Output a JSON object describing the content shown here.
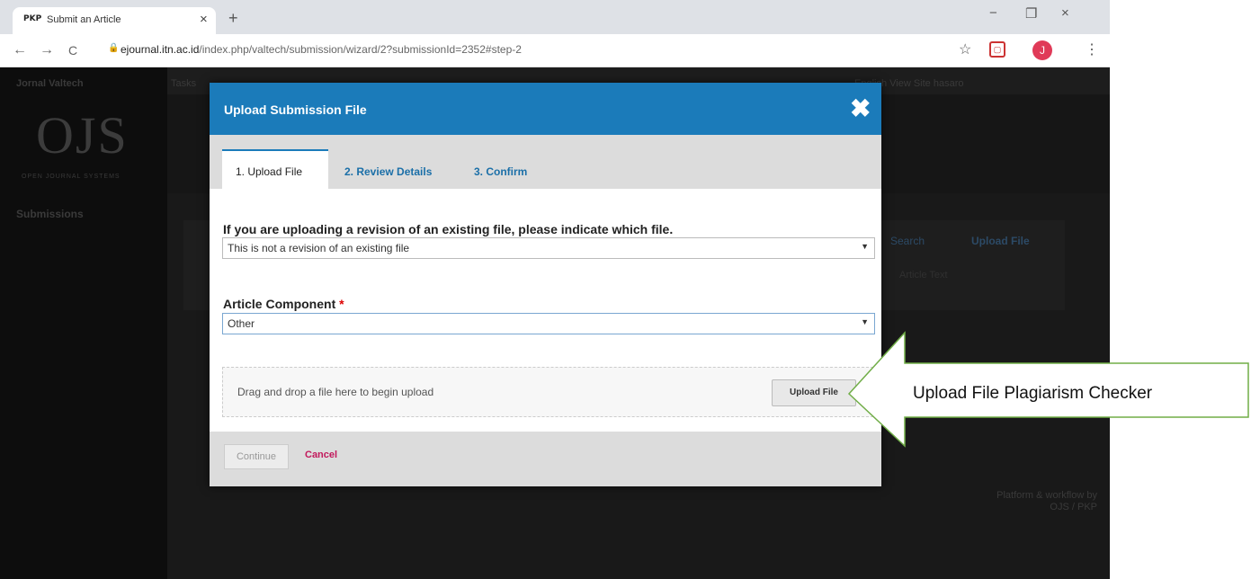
{
  "browser": {
    "tab_favicon": "PKP",
    "tab_title": "Submit an Article",
    "tab_close": "×",
    "new_tab": "+",
    "url_host": "ejournal.itn.ac.id",
    "url_path": "/index.php/valtech/submission/wizard/2?submissionId=2352#step-2",
    "profile_initial": "J",
    "window_controls": [
      "−",
      "❐",
      "×"
    ],
    "nav_icons": [
      "←",
      "→",
      "C"
    ]
  },
  "page": {
    "journal_name": "Jornal Valtech",
    "logo": "OJS",
    "logo_tagline": "OPEN JOURNAL SYSTEMS",
    "nav_submissions": "Submissions",
    "topbar_tasks": "Tasks",
    "topbar_right": "English    View Site    hasaro",
    "bg_search": "Search",
    "bg_upload_file": "Upload File",
    "bg_article_text": "Article Text",
    "footer": "Platform & workflow by OJS / PKP"
  },
  "modal": {
    "title": "Upload Submission File",
    "close": "✖",
    "tabs": [
      "1. Upload File",
      "2. Review Details",
      "3. Confirm"
    ],
    "revision_label": "If you are uploading a revision of an existing file, please indicate which file.",
    "revision_value": "This is not a revision of an existing file",
    "component_label": "Article Component",
    "component_required": "*",
    "component_value": "Other",
    "dropzone_text": "Drag and drop a file here to begin upload",
    "upload_button": "Upload File",
    "continue_button": "Continue",
    "cancel_link": "Cancel"
  },
  "callout": {
    "text": "Upload File Plagiarism Checker"
  }
}
